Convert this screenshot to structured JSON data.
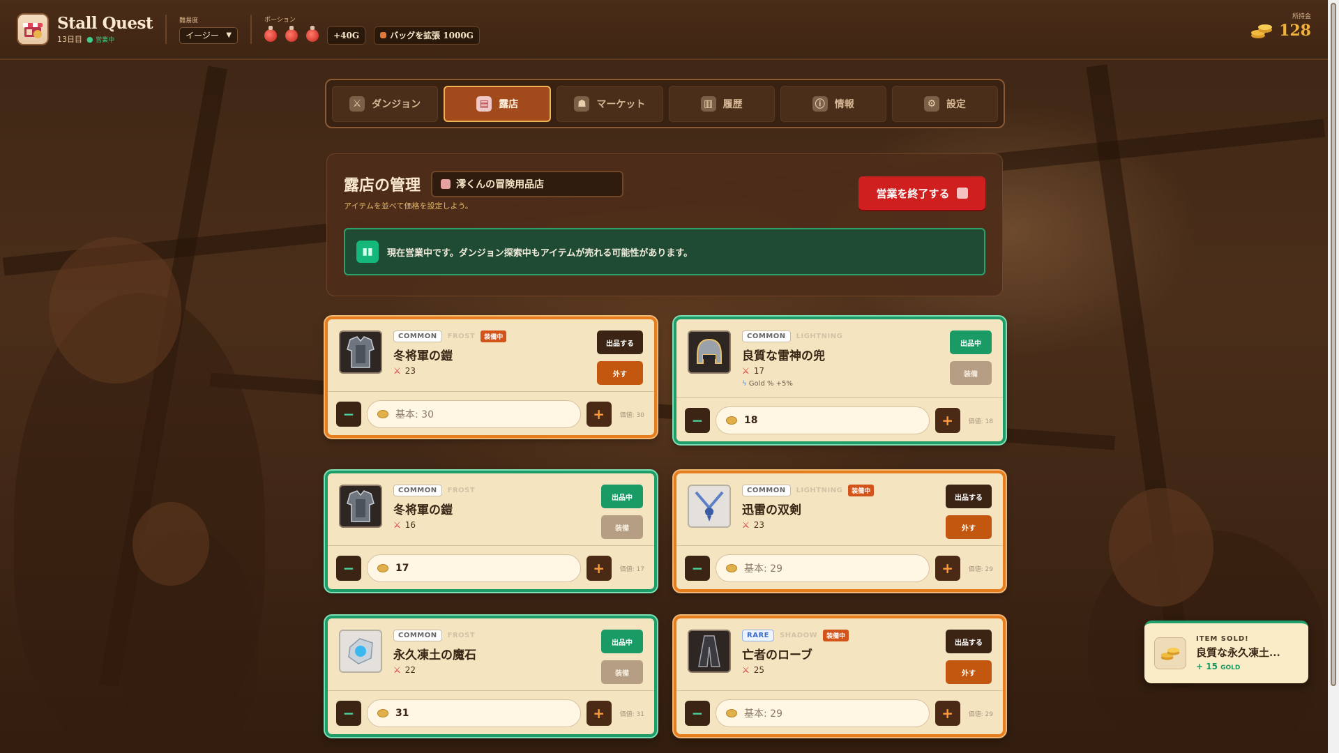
{
  "header": {
    "title": "Stall Quest",
    "day": "13日目",
    "status": "営業中",
    "difficulty_label": "難易度",
    "difficulty_value": "イージー",
    "potion_label": "ポーション",
    "gold_bonus": "+40G",
    "bag_expand": "バッグを拡張 1000G",
    "gold_label": "所持金",
    "gold_value": "128"
  },
  "tabs": [
    {
      "label": "ダンジョン",
      "icon": "crossed-swords-icon"
    },
    {
      "label": "露店",
      "icon": "stall-icon"
    },
    {
      "label": "マーケット",
      "icon": "market-icon"
    },
    {
      "label": "履歴",
      "icon": "history-icon"
    },
    {
      "label": "情報",
      "icon": "info-icon"
    },
    {
      "label": "設定",
      "icon": "gear-icon"
    }
  ],
  "panel": {
    "title": "露店の管理",
    "shop_name": "澪くんの冒険用品店",
    "hint": "アイテムを並べて価格を設定しよう。",
    "end_button": "営業を終了する",
    "status_message": "現在営業中です。ダンジョン探索中もアイテムが売れる可能性があります。"
  },
  "items": [
    {
      "rarity": "COMMON",
      "element": "FROST",
      "equipped": "装備中",
      "name": "冬将軍の鎧",
      "attack": "23",
      "bonus": "",
      "btn1": "出品する",
      "btn2": "外す",
      "price": "",
      "placeholder": "基本: 30",
      "value_note": "価値: 30"
    },
    {
      "rarity": "COMMON",
      "element": "LIGHTNING",
      "equipped": "",
      "name": "良質な雷神の兜",
      "attack": "17",
      "bonus": "Gold % +5%",
      "btn1": "出品中",
      "btn2": "装備",
      "price": "18",
      "placeholder": "",
      "value_note": "価値: 18"
    },
    {
      "rarity": "COMMON",
      "element": "FROST",
      "equipped": "",
      "name": "冬将軍の鎧",
      "attack": "16",
      "bonus": "",
      "btn1": "出品中",
      "btn2": "装備",
      "price": "17",
      "placeholder": "",
      "value_note": "価値: 17"
    },
    {
      "rarity": "COMMON",
      "element": "LIGHTNING",
      "equipped": "装備中",
      "name": "迅雷の双剣",
      "attack": "23",
      "bonus": "",
      "btn1": "出品する",
      "btn2": "外す",
      "price": "",
      "placeholder": "基本: 29",
      "value_note": "価値: 29"
    },
    {
      "rarity": "COMMON",
      "element": "FROST",
      "equipped": "",
      "name": "永久凍土の魔石",
      "attack": "22",
      "bonus": "",
      "btn1": "出品中",
      "btn2": "装備",
      "price": "31",
      "placeholder": "",
      "value_note": "価値: 31"
    },
    {
      "rarity": "RARE",
      "element": "SHADOW",
      "equipped": "装備中",
      "name": "亡者のローブ",
      "attack": "25",
      "bonus": "",
      "btn1": "出品する",
      "btn2": "外す",
      "price": "",
      "placeholder": "基本: 29",
      "value_note": "価値: 29"
    }
  ],
  "toast": {
    "title": "ITEM SOLD!",
    "item": "良質な永久凍土...",
    "amount": "+ 15",
    "unit": "GOLD"
  },
  "colors": {
    "accent_orange": "#e67e1f",
    "listed_green": "#1e9d6a",
    "danger_red": "#cf1f1f",
    "gold": "#f2b33c"
  }
}
